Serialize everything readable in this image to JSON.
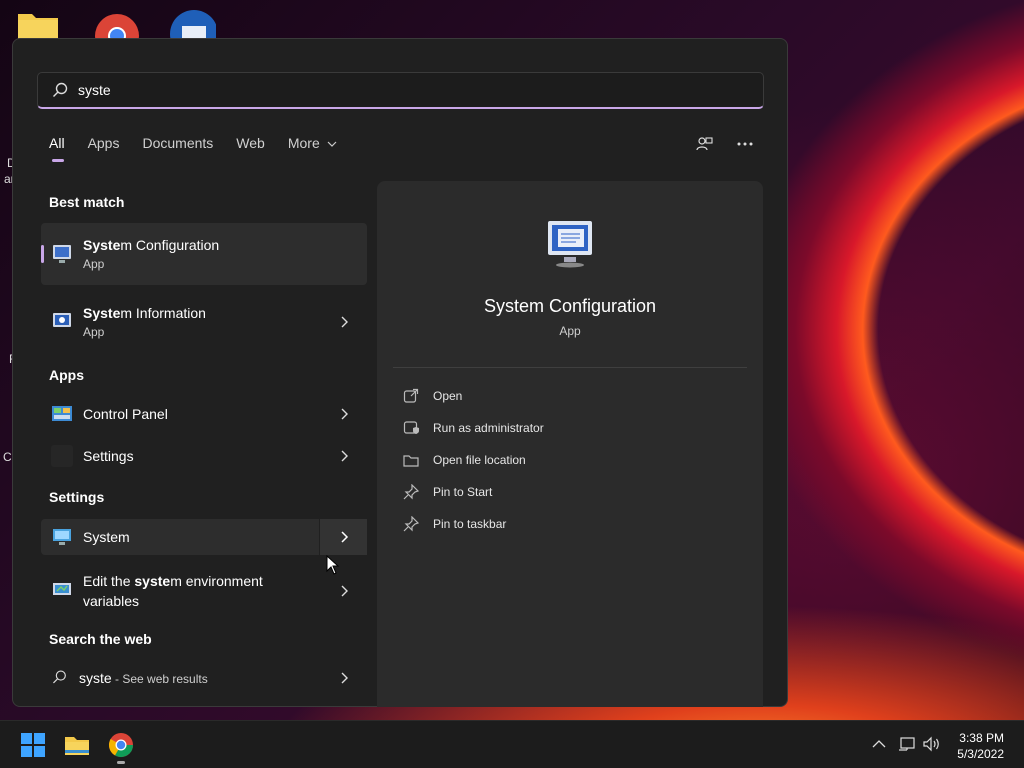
{
  "desktop": {
    "icons": [
      "folder-icon",
      "chrome-icon",
      "thunderbird-icon"
    ],
    "cut_labels": [
      "D",
      "ar",
      "F",
      "Co"
    ]
  },
  "search": {
    "value": "syste",
    "placeholder": ""
  },
  "tabs": [
    {
      "label": "All",
      "active": true
    },
    {
      "label": "Apps"
    },
    {
      "label": "Documents"
    },
    {
      "label": "Web"
    },
    {
      "label": "More"
    }
  ],
  "sections": {
    "best_match": "Best match",
    "apps": "Apps",
    "settings": "Settings",
    "web": "Search the web"
  },
  "results": {
    "system_config": {
      "bold": "Syste",
      "rest": "m Configuration",
      "sub": "App"
    },
    "system_info": {
      "bold": "Syste",
      "rest": "m Information",
      "sub": "App"
    },
    "control_panel": {
      "name": "Control Panel"
    },
    "settings": {
      "name": "Settings"
    },
    "system": {
      "name": "System"
    },
    "env_vars": {
      "pre": "Edit the ",
      "bold": "syste",
      "rest": "m environment",
      "line2": "variables"
    },
    "web": {
      "query": "syste",
      "suffix": " - See web results"
    }
  },
  "detail": {
    "title": "System Configuration",
    "subtitle": "App",
    "actions": [
      "Open",
      "Run as administrator",
      "Open file location",
      "Pin to Start",
      "Pin to taskbar"
    ]
  },
  "taskbar": {
    "time": "3:38 PM",
    "date": "5/3/2022",
    "accent": "#c9a7e8"
  }
}
